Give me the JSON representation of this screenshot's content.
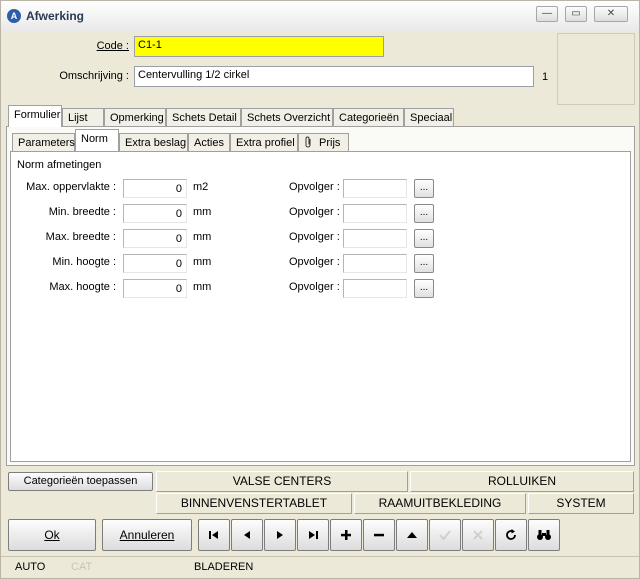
{
  "window": {
    "title": "Afwerking",
    "min": "—",
    "max": "▭",
    "close": "✕"
  },
  "form": {
    "code_label": "Code :",
    "code_value": "C1-1",
    "desc_label": "Omschrijving :",
    "desc_value": "Centervulling 1/2 cirkel",
    "count": "1"
  },
  "tabs_top": [
    "Formulier",
    "Lijst",
    "Opmerking",
    "Schets Detail",
    "Schets Overzicht",
    "Categorieën",
    "Speciaal"
  ],
  "tabs_sub": [
    "Parameters",
    "Norm",
    "Extra beslag",
    "Acties",
    "Extra profiel",
    "Prijs"
  ],
  "section_title": "Norm afmetingen",
  "rows": [
    {
      "label": "Max. oppervlakte :",
      "value": "0",
      "unit": "m2",
      "opv_label": "Opvolger :"
    },
    {
      "label": "Min. breedte :",
      "value": "0",
      "unit": "mm",
      "opv_label": "Opvolger :"
    },
    {
      "label": "Max. breedte :",
      "value": "0",
      "unit": "mm",
      "opv_label": "Opvolger :"
    },
    {
      "label": "Min. hoogte :",
      "value": "0",
      "unit": "mm",
      "opv_label": "Opvolger :"
    },
    {
      "label": "Max. hoogte :",
      "value": "0",
      "unit": "mm",
      "opv_label": "Opvolger :"
    }
  ],
  "dots_label": "...",
  "categories": {
    "apply": "Categorieën toepassen",
    "valse": "VALSE CENTERS",
    "rolluiken": "ROLLUIKEN",
    "binnen": "BINNENVENSTERTABLET",
    "raam": "RAAMUITBEKLEDING",
    "systeem": "SYSTEM"
  },
  "buttons": {
    "ok": "Ok",
    "cancel": "Annuleren"
  },
  "status": {
    "auto": "AUTO",
    "cat": "CAT",
    "mode": "BLADEREN"
  }
}
